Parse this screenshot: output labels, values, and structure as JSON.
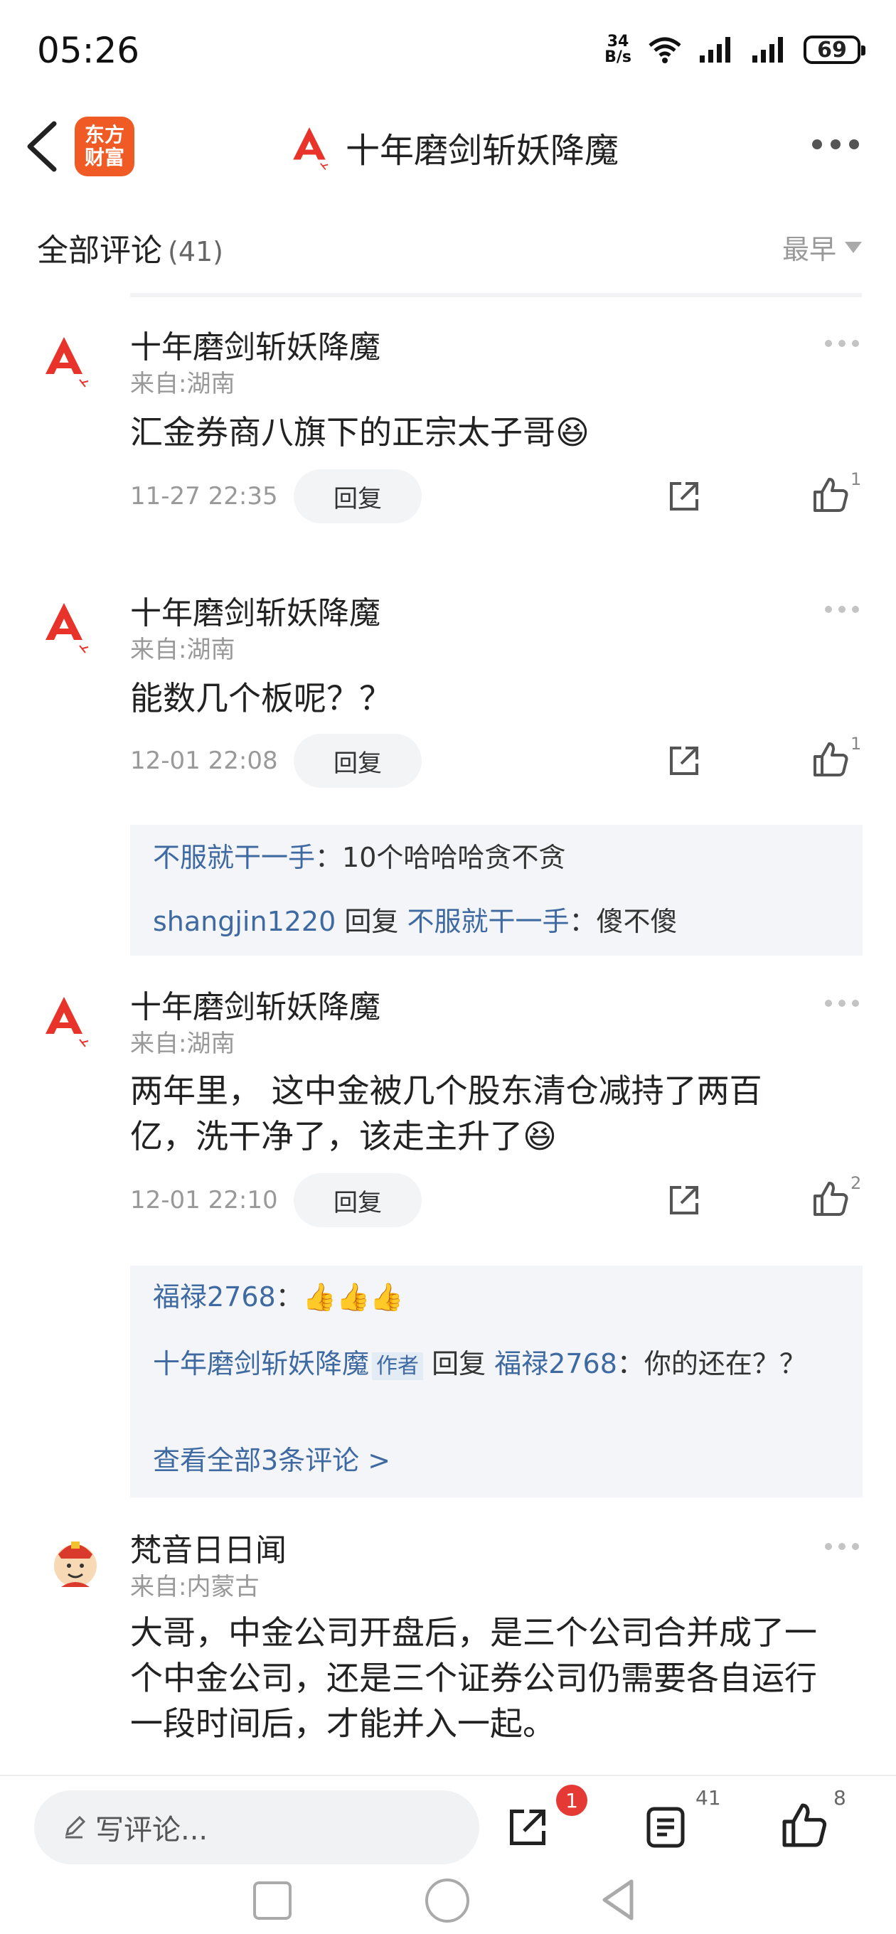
{
  "status_bar": {
    "time": "05:26",
    "net_speed_value": "34",
    "net_speed_unit": "B/s",
    "battery": "69"
  },
  "header": {
    "app_logo_line1": "东方",
    "app_logo_line2": "财富",
    "title": "十年磨剑斩妖降魔"
  },
  "comments_header": {
    "label": "全部评论",
    "count": "(41)",
    "sort": "最早"
  },
  "comments": [
    {
      "name": "十年磨剑斩妖降魔",
      "location": "来自:湖南",
      "text": "汇金券商八旗下的正宗太子哥😆",
      "time": "11-27 22:35",
      "reply_label": "回复",
      "likes": "1"
    },
    {
      "name": "十年磨剑斩妖降魔",
      "location": "来自:湖南",
      "text": "能数几个板呢？？",
      "time": "12-01 22:08",
      "reply_label": "回复",
      "likes": "1",
      "replies": [
        {
          "user": "不服就干一手",
          "sep": "：",
          "text": "10个哈哈哈贪不贪"
        },
        {
          "user": "shangjin1220",
          "mid": " 回复 ",
          "target": "不服就干一手",
          "sep": "：",
          "text": "傻不傻"
        }
      ]
    },
    {
      "name": "十年磨剑斩妖降魔",
      "location": "来自:湖南",
      "text_line1": "两年里， 这中金被几个股东清仓减持了两百",
      "text_line2": "亿，洗干净了，该走主升了😆",
      "time": "12-01 22:10",
      "reply_label": "回复",
      "likes": "2",
      "replies": [
        {
          "user": "福禄2768",
          "sep": "：",
          "text": "👍👍👍"
        },
        {
          "user": "十年磨剑斩妖降魔",
          "tag": "作者",
          "mid": " 回复 ",
          "target": "福禄2768",
          "sep": "：",
          "text": "你的还在？？"
        }
      ],
      "view_all": "查看全部3条评论 >"
    },
    {
      "name": "梵音日日闻",
      "location": "来自:内蒙古",
      "text_line1": "大哥，中金公司开盘后，是三个公司合并成了一",
      "text_line2": "个中金公司，还是三个证券公司仍需要各自运行",
      "text_line3": "一段时间后，才能并入一起。"
    }
  ],
  "bottom_bar": {
    "input_placeholder": "写评论...",
    "share_badge": "1",
    "comment_count": "41",
    "like_count": "8"
  },
  "colors": {
    "brand": "#f05a24",
    "link_blue": "#3f6aa1",
    "badge_red": "#e53935",
    "avatar_red": "#e8332a"
  }
}
